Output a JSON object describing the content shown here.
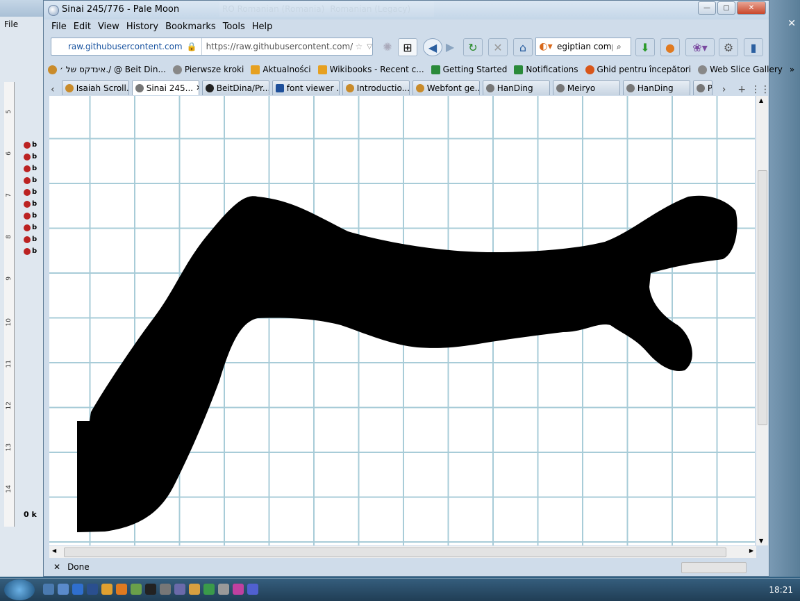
{
  "window": {
    "title": "Sinai 245/776 - Pale Moon",
    "inactive_title": "RO Romanian (Romania)",
    "inactive_title2": "Romanian (Legacy)"
  },
  "menu": [
    "File",
    "Edit",
    "View",
    "History",
    "Bookmarks",
    "Tools",
    "Help"
  ],
  "urlbar": {
    "identity": "raw.githubusercontent.com",
    "url": "https://raw.githubusercontent.com/BeitD"
  },
  "search": {
    "value": "egiptian comp"
  },
  "bookmarks": [
    {
      "label": "אינדקס של ׳./ @ Beit Din...",
      "color": "#c98b2a"
    },
    {
      "label": "Pierwsze kroki",
      "color": "#888"
    },
    {
      "label": "Aktualności",
      "color": "#e6a020"
    },
    {
      "label": "Wikibooks  - Recent c...",
      "color": "#e6a020"
    },
    {
      "label": "Getting Started",
      "color": "#2a8a3a"
    },
    {
      "label": "Notifications",
      "color": "#2a8a3a"
    },
    {
      "label": "Ghid pentru începători",
      "color": "#d8561a"
    },
    {
      "label": "Web Slice Gallery",
      "color": "#888"
    }
  ],
  "tabs": [
    {
      "label": "Isaiah Scroll...",
      "active": false
    },
    {
      "label": "Sinai 245...",
      "active": true
    },
    {
      "label": "BeitDina/Pr...",
      "active": false
    },
    {
      "label": "font viewer ...",
      "active": false
    },
    {
      "label": "Introductio...",
      "active": false
    },
    {
      "label": "Webfont ge...",
      "active": false
    },
    {
      "label": "HanDing",
      "active": false
    },
    {
      "label": "Meiryo",
      "active": false
    },
    {
      "label": "HanDing",
      "active": false
    },
    {
      "label": "P",
      "active": false
    }
  ],
  "status": {
    "text": "Done"
  },
  "left_window": {
    "menu": "File",
    "footer": "0 k"
  },
  "clock": {
    "time": "18:21"
  },
  "ruler_marks": [
    "5",
    "6",
    "7",
    "8",
    "9",
    "10",
    "11",
    "12",
    "13",
    "14"
  ]
}
